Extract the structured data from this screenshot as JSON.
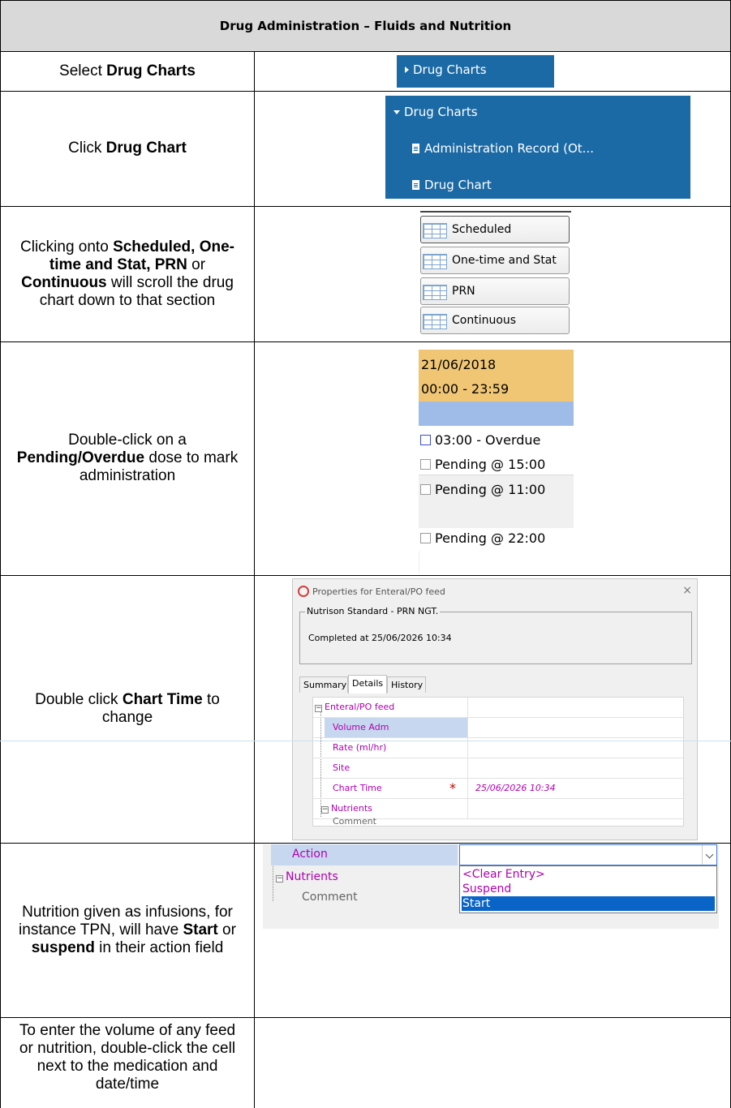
{
  "header": {
    "title": "Drug Administration – Fluids and Nutrition"
  },
  "rows": [
    {
      "pre": "Select ",
      "bold": "Drug Charts"
    },
    {
      "pre": "Click ",
      "bold": "Drug Chart"
    },
    {
      "bold1": "Scheduled, One-time and Stat, PRN",
      "mid": " or ",
      "bold2": "Continuous",
      "pre": "Clicking onto ",
      "post": " will scroll the drug chart down to that section"
    },
    {
      "pre": "Double-click on a ",
      "bold": "Pending/Overdue",
      "post": " dose to mark administration"
    },
    {
      "pre": "Double click ",
      "bold": "Chart Time",
      "post": " to change"
    },
    {
      "pre": "Nutrition given as infusions, for instance TPN, will have ",
      "bold1": "Start",
      "mid": " or ",
      "bold2": "suspend",
      "post": " in their action field"
    },
    {
      "text": "To enter the volume of any feed or nutrition, double-click the cell next to the medication and date/time"
    }
  ],
  "nav1": {
    "label": "Drug Charts"
  },
  "nav2": {
    "header": "Drug Charts",
    "items": [
      "Administration Record (Ot...",
      "Drug Chart"
    ]
  },
  "sections": [
    "Scheduled",
    "One-time and Stat",
    "PRN",
    "Continuous"
  ],
  "pending": {
    "date": "21/06/2018",
    "range": "00:00 - 23:59",
    "items": [
      "03:00 - Overdue",
      "Pending @ 15:00",
      "Pending @ 11:00",
      "Pending @ 22:00"
    ]
  },
  "dialog": {
    "title": "Properties for Enteral/PO feed",
    "close": "×",
    "group_caption": "Nutrison Standard - PRN NGT.",
    "completed": "Completed at 25/06/2026 10:34",
    "tabs": [
      "Summary",
      "Details",
      "History"
    ],
    "tree": {
      "root": "Enteral/PO feed",
      "fields": [
        "Volume Adm",
        "Rate (ml/hr)",
        "Site",
        "Chart Time"
      ],
      "chart_time_value": "25/06/2026 10:34",
      "required_mark": "*",
      "nutrients": "Nutrients",
      "comment": "Comment"
    }
  },
  "action": {
    "label": "Action",
    "nutrients": "Nutrients",
    "comment": "Comment",
    "options": [
      "<Clear Entry>",
      "Suspend",
      "Start"
    ],
    "selected": "Start"
  }
}
